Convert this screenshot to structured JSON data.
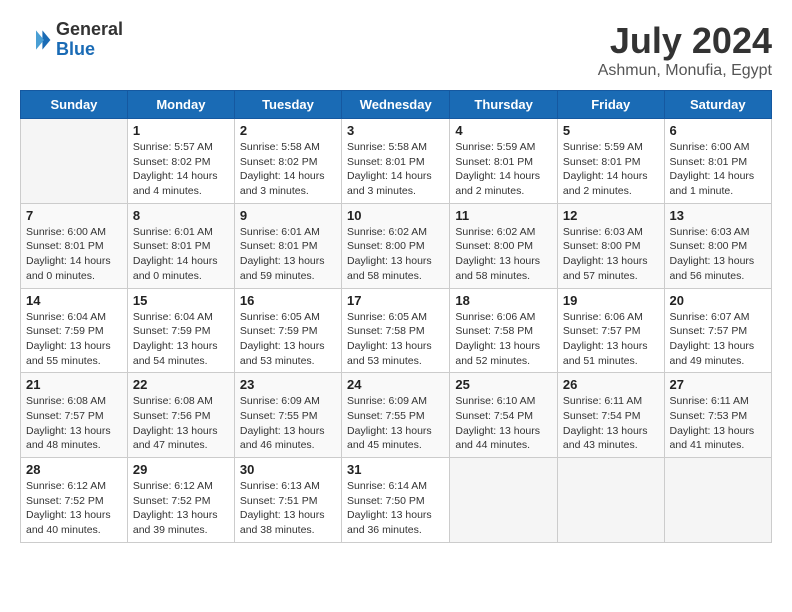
{
  "header": {
    "logo": {
      "line1": "General",
      "line2": "Blue"
    },
    "title": "July 2024",
    "location": "Ashmun, Monufia, Egypt"
  },
  "weekdays": [
    "Sunday",
    "Monday",
    "Tuesday",
    "Wednesday",
    "Thursday",
    "Friday",
    "Saturday"
  ],
  "weeks": [
    [
      {
        "day": null
      },
      {
        "day": "1",
        "sunrise": "5:57 AM",
        "sunset": "8:02 PM",
        "daylight": "14 hours and 4 minutes."
      },
      {
        "day": "2",
        "sunrise": "5:58 AM",
        "sunset": "8:02 PM",
        "daylight": "14 hours and 3 minutes."
      },
      {
        "day": "3",
        "sunrise": "5:58 AM",
        "sunset": "8:01 PM",
        "daylight": "14 hours and 3 minutes."
      },
      {
        "day": "4",
        "sunrise": "5:59 AM",
        "sunset": "8:01 PM",
        "daylight": "14 hours and 2 minutes."
      },
      {
        "day": "5",
        "sunrise": "5:59 AM",
        "sunset": "8:01 PM",
        "daylight": "14 hours and 2 minutes."
      },
      {
        "day": "6",
        "sunrise": "6:00 AM",
        "sunset": "8:01 PM",
        "daylight": "14 hours and 1 minute."
      }
    ],
    [
      {
        "day": "7",
        "sunrise": "6:00 AM",
        "sunset": "8:01 PM",
        "daylight": "14 hours and 0 minutes."
      },
      {
        "day": "8",
        "sunrise": "6:01 AM",
        "sunset": "8:01 PM",
        "daylight": "14 hours and 0 minutes."
      },
      {
        "day": "9",
        "sunrise": "6:01 AM",
        "sunset": "8:01 PM",
        "daylight": "13 hours and 59 minutes."
      },
      {
        "day": "10",
        "sunrise": "6:02 AM",
        "sunset": "8:00 PM",
        "daylight": "13 hours and 58 minutes."
      },
      {
        "day": "11",
        "sunrise": "6:02 AM",
        "sunset": "8:00 PM",
        "daylight": "13 hours and 58 minutes."
      },
      {
        "day": "12",
        "sunrise": "6:03 AM",
        "sunset": "8:00 PM",
        "daylight": "13 hours and 57 minutes."
      },
      {
        "day": "13",
        "sunrise": "6:03 AM",
        "sunset": "8:00 PM",
        "daylight": "13 hours and 56 minutes."
      }
    ],
    [
      {
        "day": "14",
        "sunrise": "6:04 AM",
        "sunset": "7:59 PM",
        "daylight": "13 hours and 55 minutes."
      },
      {
        "day": "15",
        "sunrise": "6:04 AM",
        "sunset": "7:59 PM",
        "daylight": "13 hours and 54 minutes."
      },
      {
        "day": "16",
        "sunrise": "6:05 AM",
        "sunset": "7:59 PM",
        "daylight": "13 hours and 53 minutes."
      },
      {
        "day": "17",
        "sunrise": "6:05 AM",
        "sunset": "7:58 PM",
        "daylight": "13 hours and 53 minutes."
      },
      {
        "day": "18",
        "sunrise": "6:06 AM",
        "sunset": "7:58 PM",
        "daylight": "13 hours and 52 minutes."
      },
      {
        "day": "19",
        "sunrise": "6:06 AM",
        "sunset": "7:57 PM",
        "daylight": "13 hours and 51 minutes."
      },
      {
        "day": "20",
        "sunrise": "6:07 AM",
        "sunset": "7:57 PM",
        "daylight": "13 hours and 49 minutes."
      }
    ],
    [
      {
        "day": "21",
        "sunrise": "6:08 AM",
        "sunset": "7:57 PM",
        "daylight": "13 hours and 48 minutes."
      },
      {
        "day": "22",
        "sunrise": "6:08 AM",
        "sunset": "7:56 PM",
        "daylight": "13 hours and 47 minutes."
      },
      {
        "day": "23",
        "sunrise": "6:09 AM",
        "sunset": "7:55 PM",
        "daylight": "13 hours and 46 minutes."
      },
      {
        "day": "24",
        "sunrise": "6:09 AM",
        "sunset": "7:55 PM",
        "daylight": "13 hours and 45 minutes."
      },
      {
        "day": "25",
        "sunrise": "6:10 AM",
        "sunset": "7:54 PM",
        "daylight": "13 hours and 44 minutes."
      },
      {
        "day": "26",
        "sunrise": "6:11 AM",
        "sunset": "7:54 PM",
        "daylight": "13 hours and 43 minutes."
      },
      {
        "day": "27",
        "sunrise": "6:11 AM",
        "sunset": "7:53 PM",
        "daylight": "13 hours and 41 minutes."
      }
    ],
    [
      {
        "day": "28",
        "sunrise": "6:12 AM",
        "sunset": "7:52 PM",
        "daylight": "13 hours and 40 minutes."
      },
      {
        "day": "29",
        "sunrise": "6:12 AM",
        "sunset": "7:52 PM",
        "daylight": "13 hours and 39 minutes."
      },
      {
        "day": "30",
        "sunrise": "6:13 AM",
        "sunset": "7:51 PM",
        "daylight": "13 hours and 38 minutes."
      },
      {
        "day": "31",
        "sunrise": "6:14 AM",
        "sunset": "7:50 PM",
        "daylight": "13 hours and 36 minutes."
      },
      {
        "day": null
      },
      {
        "day": null
      },
      {
        "day": null
      }
    ]
  ]
}
